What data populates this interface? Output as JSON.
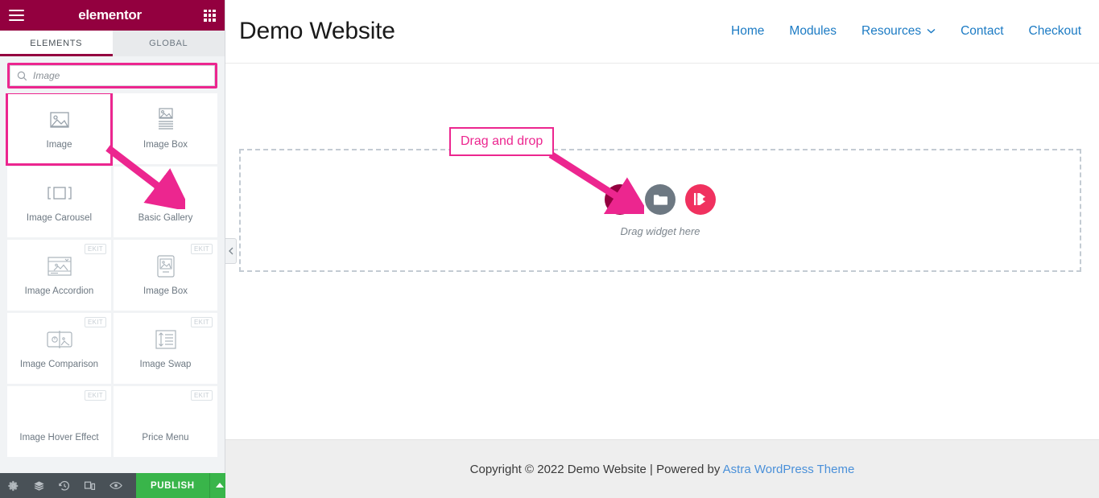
{
  "panel": {
    "brand": "elementor",
    "menu_icon": "hamburger-icon",
    "apps_icon": "apps-grid-icon",
    "tabs": [
      {
        "label": "ELEMENTS",
        "active": true
      },
      {
        "label": "GLOBAL",
        "active": false
      }
    ],
    "search": {
      "value": "Image",
      "placeholder": "Image",
      "icon": "search-icon"
    },
    "widgets": [
      {
        "label": "Image",
        "icon": "image-icon",
        "badge": "",
        "selected": true
      },
      {
        "label": "Image Box",
        "icon": "image-box-icon",
        "badge": "",
        "selected": false
      },
      {
        "label": "Image Carousel",
        "icon": "image-carousel-icon",
        "badge": "",
        "selected": false
      },
      {
        "label": "Basic Gallery",
        "icon": "basic-gallery-icon",
        "badge": "",
        "selected": false
      },
      {
        "label": "Image Accordion",
        "icon": "image-accordion-icon",
        "badge": "EKIT",
        "selected": false
      },
      {
        "label": "Image Box",
        "icon": "image-box-ekit-icon",
        "badge": "EKIT",
        "selected": false
      },
      {
        "label": "Image Comparison",
        "icon": "image-comparison-icon",
        "badge": "EKIT",
        "selected": false
      },
      {
        "label": "Image Swap",
        "icon": "image-swap-icon",
        "badge": "EKIT",
        "selected": false
      },
      {
        "label": "Image Hover Effect",
        "icon": "image-hover-icon",
        "badge": "EKIT",
        "selected": false
      },
      {
        "label": "Price Menu",
        "icon": "price-menu-icon",
        "badge": "EKIT",
        "selected": false
      }
    ],
    "footer": {
      "icons": [
        "settings-gear-icon",
        "navigator-layers-icon",
        "history-clock-icon",
        "responsive-preview-icon",
        "preview-eye-icon"
      ],
      "publish_label": "PUBLISH",
      "publish_arrow_icon": "chevron-up-icon"
    },
    "collapse_icon": "chevron-left-icon"
  },
  "canvas": {
    "site_title": "Demo Website",
    "nav": [
      {
        "label": "Home",
        "has_dropdown": false
      },
      {
        "label": "Modules",
        "has_dropdown": false
      },
      {
        "label": "Resources",
        "has_dropdown": true
      },
      {
        "label": "Contact",
        "has_dropdown": false
      },
      {
        "label": "Checkout",
        "has_dropdown": false
      }
    ],
    "dropzone": {
      "label": "Drag widget here",
      "buttons": [
        {
          "name": "add-new-section",
          "icon": "plus-icon",
          "color": "#93003f"
        },
        {
          "name": "add-template",
          "icon": "folder-icon",
          "color": "#6d7882"
        },
        {
          "name": "add-ekit-block",
          "icon": "ekit-icon",
          "color": "#f0315f"
        }
      ]
    },
    "footer": {
      "prefix": "Copyright © 2022 Demo Website | Powered by ",
      "link": "Astra WordPress Theme"
    }
  },
  "annotation": {
    "label": "Drag and drop",
    "color": "#ec268f"
  }
}
